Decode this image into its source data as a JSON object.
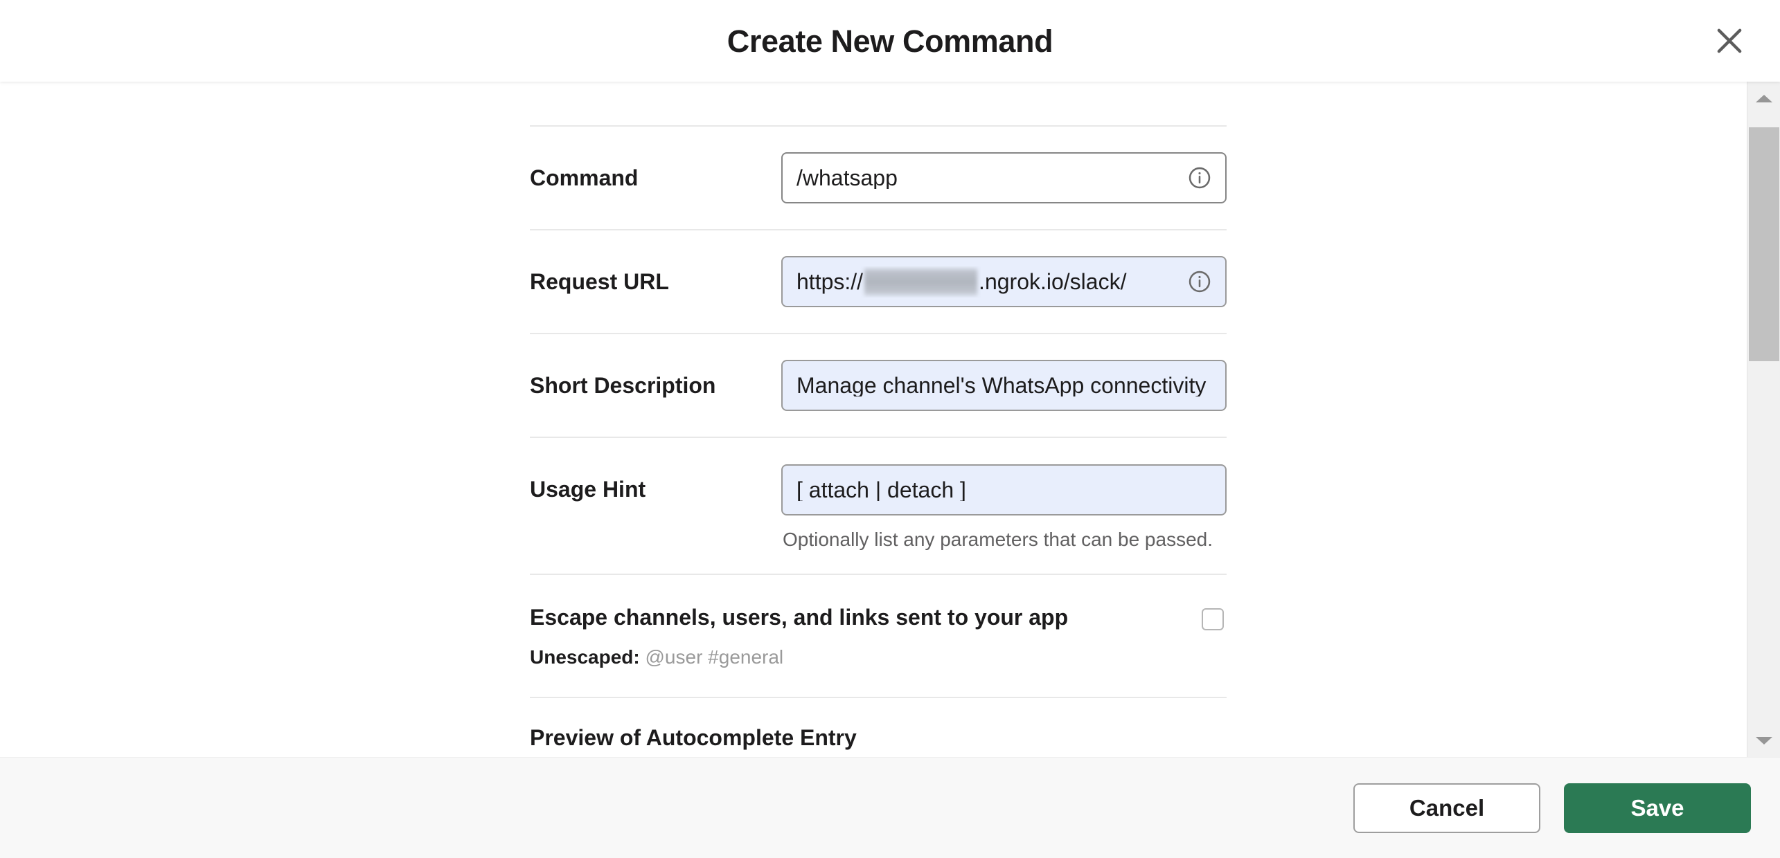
{
  "header": {
    "title": "Create New Command",
    "close_icon": "close-icon"
  },
  "form": {
    "command": {
      "label": "Command",
      "value": "/whatsapp",
      "info_icon": "info-icon"
    },
    "request_url": {
      "label": "Request URL",
      "value_prefix": "https://",
      "value_suffix": ".ngrok.io/slack/",
      "redacted": true,
      "info_icon": "info-icon"
    },
    "short_description": {
      "label": "Short Description",
      "value": "Manage channel's WhatsApp connectivity"
    },
    "usage_hint": {
      "label": "Usage Hint",
      "value": "[ attach | detach ]",
      "helper": "Optionally list any parameters that can be passed."
    },
    "escape": {
      "title": "Escape channels, users, and links sent to your app",
      "sub_label": "Unescaped:",
      "sub_value": "@user #general",
      "checked": false
    },
    "preview": {
      "title": "Preview of Autocomplete Entry"
    }
  },
  "footer": {
    "cancel_label": "Cancel",
    "save_label": "Save"
  },
  "colors": {
    "save_green": "#2b7a54",
    "autofill_blue": "#e8eefc",
    "text_primary": "#1d1c1d",
    "text_muted": "#616061"
  }
}
